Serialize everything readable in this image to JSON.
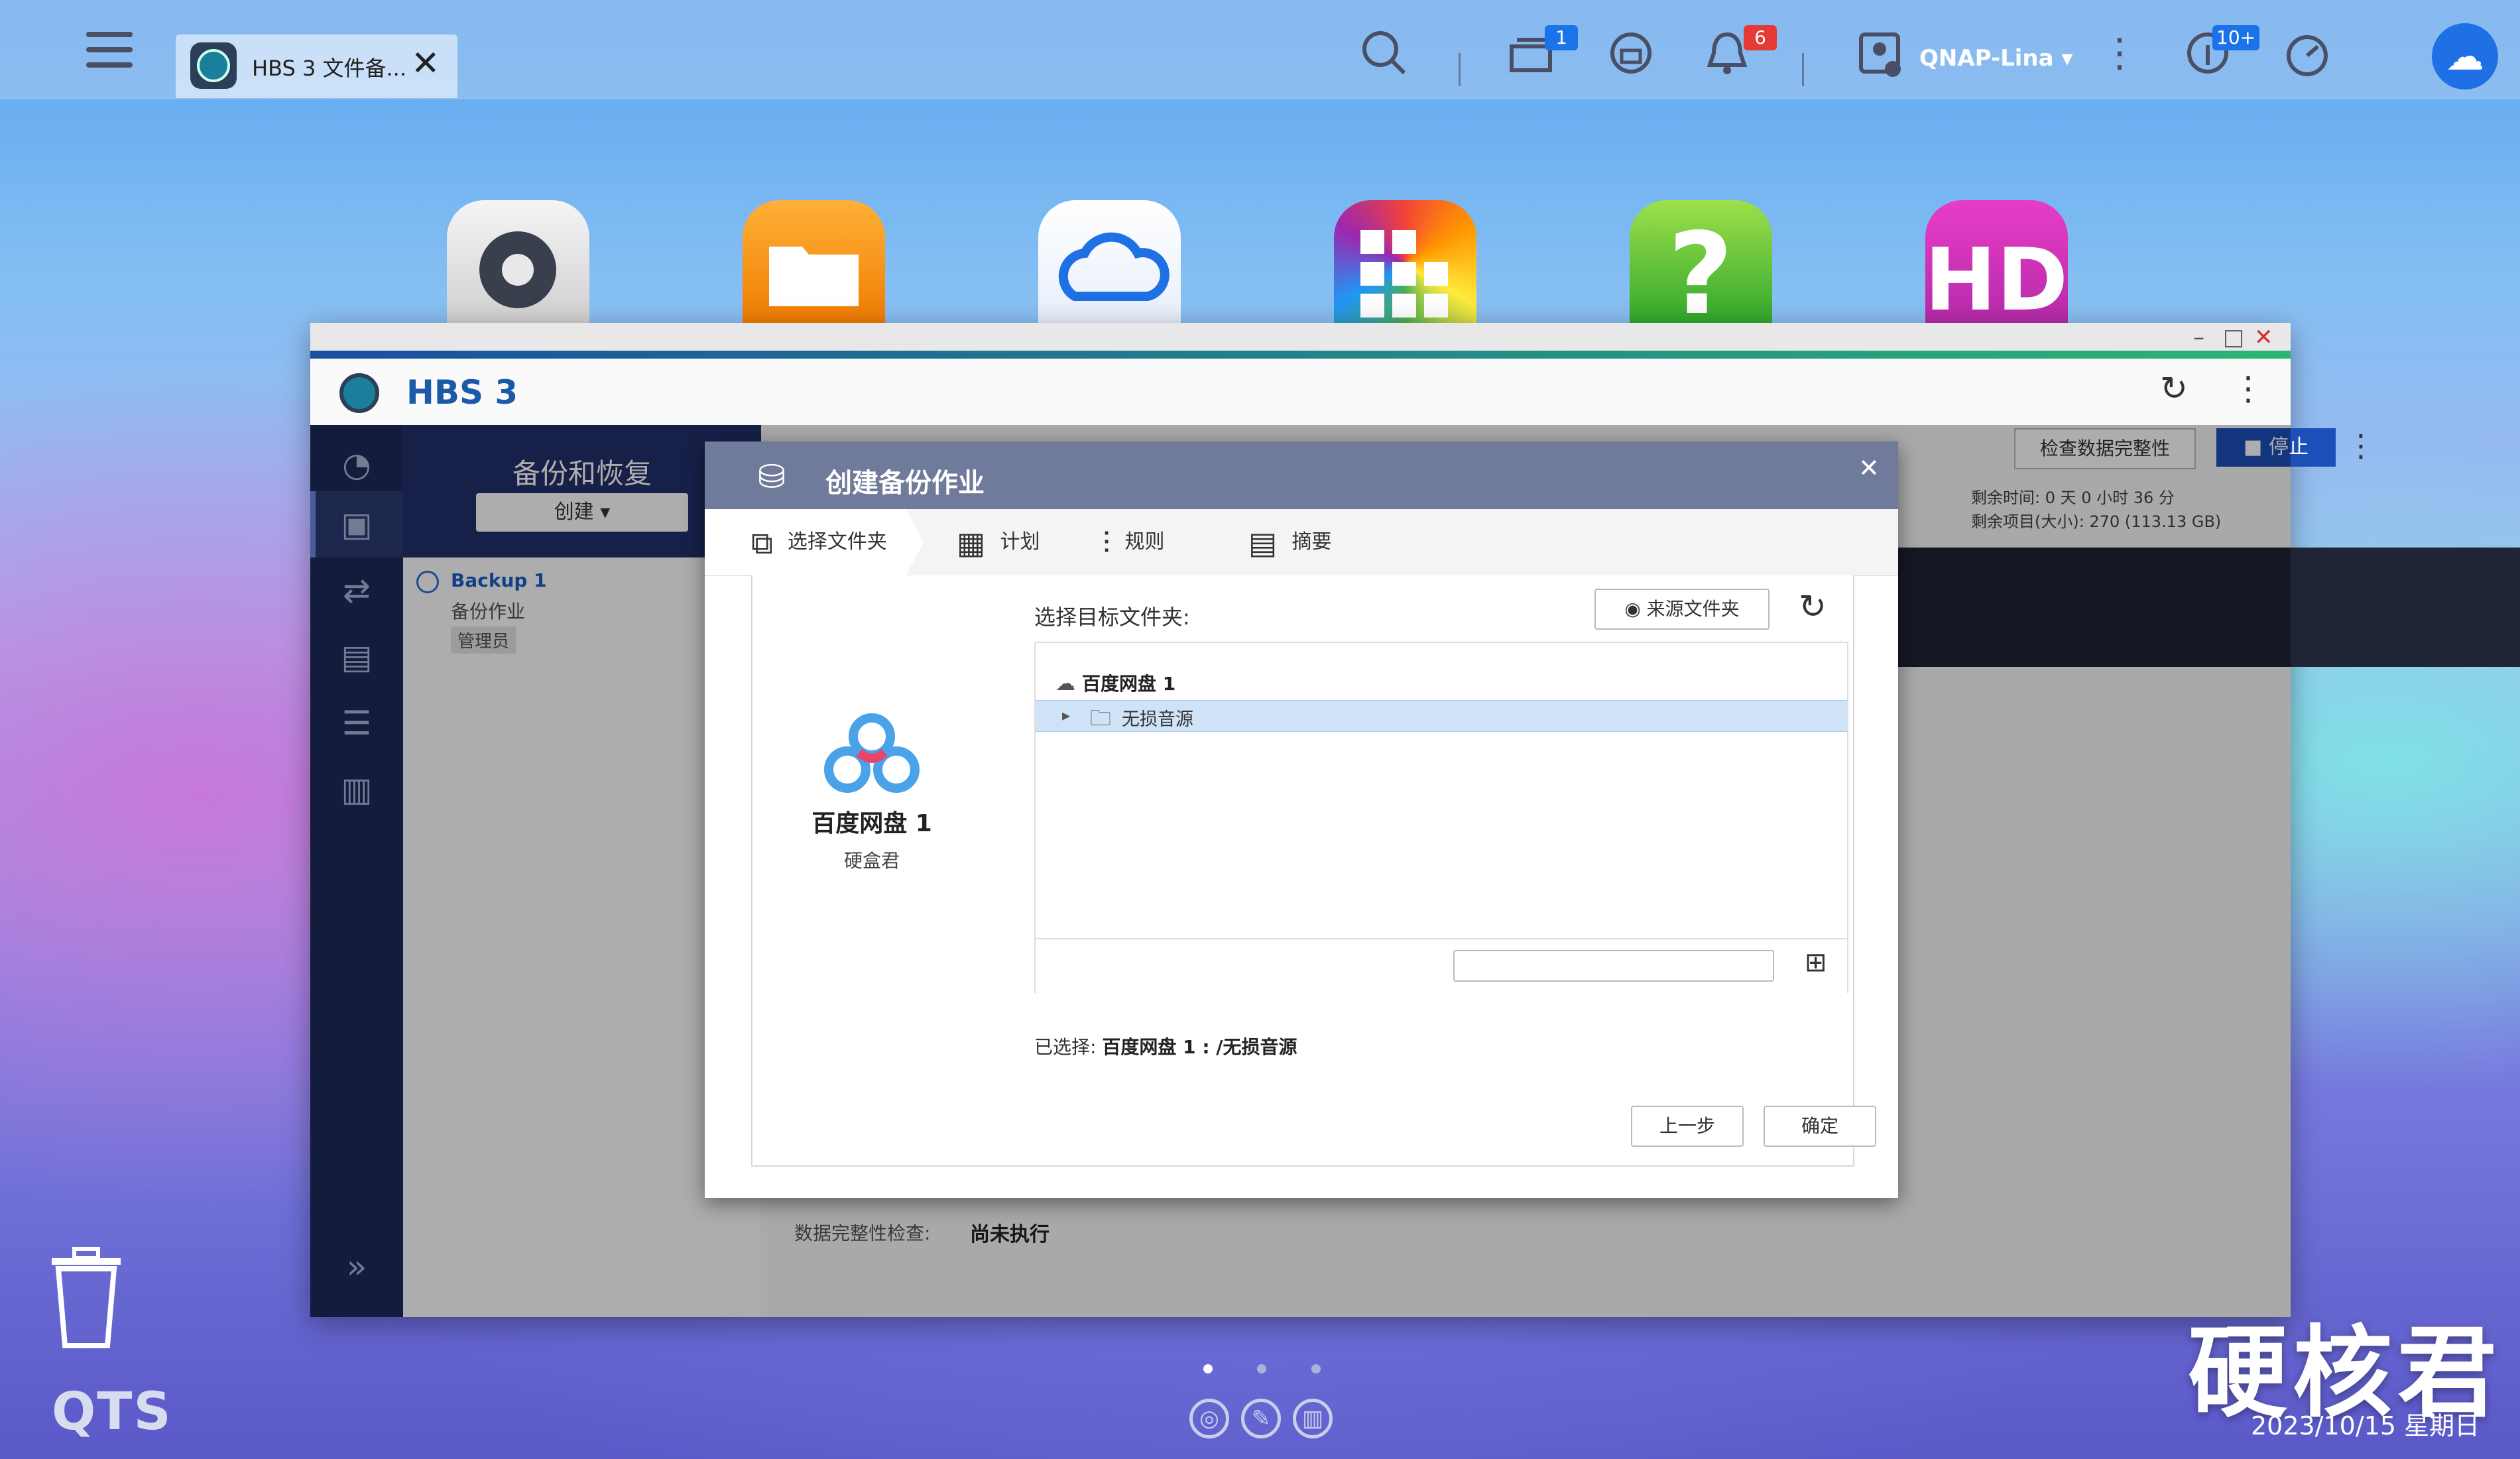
{
  "taskbar": {
    "tab_title": "HBS 3 文件备...",
    "tab_close": "✕",
    "notification_counts": {
      "tasks": "1",
      "alerts": "6",
      "updates": "10+"
    },
    "user_name": "QNAP-Lina ▾"
  },
  "window": {
    "app_name": "HBS 3",
    "left_panel_title": "备份和恢复",
    "create_button": "创建",
    "job": {
      "name": "Backup 1",
      "type": "备份作业",
      "owner": "管理员"
    },
    "main": {
      "check_integrity_btn": "检查数据完整性",
      "stop_btn": "停止",
      "remaining_time": "剩余时间: 0 天 0 小时 36 分",
      "remaining_items": "剩余项目(大小): 270 (113.13 GB)",
      "integrity_label": "数据完整性检查:",
      "integrity_value": "尚未执行"
    }
  },
  "dialog": {
    "title": "创建备份作业",
    "steps": [
      "选择文件夹",
      "计划",
      "规则",
      "摘要"
    ],
    "source": {
      "name": "百度网盘 1",
      "subtitle": "硬盒君"
    },
    "target_label": "选择目标文件夹:",
    "source_folder_btn": "来源文件夹",
    "tree_root": "百度网盘 1",
    "tree_item": "无损音源",
    "selected_prefix": "已选择:",
    "selected_path": "百度网盘 1 : /无损音源",
    "back_btn": "上一步",
    "ok_btn": "确定"
  },
  "desktop": {
    "qts_label": "QTS",
    "watermark": "硬核君",
    "datetime": "2023/10/15 星期日"
  },
  "colors": {
    "accent": "#1f6fe5",
    "dialog_header": "#707a9a",
    "sidebar": "#1e2a5a",
    "stop_button": "#1d4fb8",
    "alert_badge": "#e53935"
  }
}
